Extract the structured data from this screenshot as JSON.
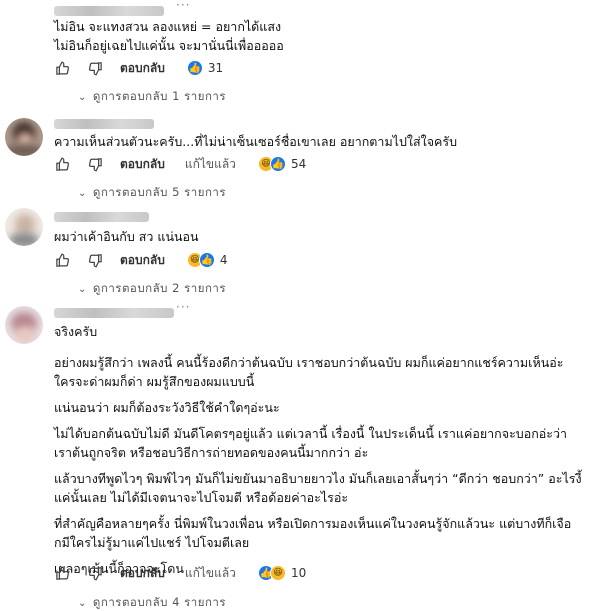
{
  "comments": [
    {
      "paragraphs": [
        "ไม่อิน จะแทงสวน ลองแหย่ = อยากได้แสง\nไม่อินก็อยู่เฉยไปแค่นั้น จะมานั่นนี่เพื่อออออ"
      ],
      "actions": {
        "reply": "ตอบกลับ",
        "edit": ""
      },
      "reactions": [
        "like"
      ],
      "reaction_count": "31",
      "replies_label": "ดูการตอบกลับ 1 รายการ"
    },
    {
      "paragraphs": [
        "ความเห็นส่วนตัวนะครับ...ที่ไม่น่าเซ็นเซอร์ชื่อเขาเลย อยากตามไปใส่ใจครับ"
      ],
      "actions": {
        "reply": "ตอบกลับ",
        "edit": "แก้ไขแล้ว"
      },
      "reactions": [
        "haha",
        "like"
      ],
      "reaction_count": "54",
      "replies_label": "ดูการตอบกลับ 5 รายการ"
    },
    {
      "paragraphs": [
        "ผมว่าเค้าอินกับ สว แน่นอน"
      ],
      "actions": {
        "reply": "ตอบกลับ",
        "edit": ""
      },
      "reactions": [
        "haha",
        "like"
      ],
      "reaction_count": "4",
      "replies_label": "ดูการตอบกลับ 2 รายการ"
    },
    {
      "paragraphs": [
        "จริงครับ",
        "อย่างผมรู้สึกว่า เพลงนี้ คนนี้ร้องดีกว่าต้นฉบับ เราชอบกว่าต้นฉบับ ผมก็แค่อยากแชร์ความเห็นอ่ะ\nใครจะด่าผมก็ด่า ผมรู้สึกของผมแบบนี้",
        "แน่นอนว่า ผมก็ต้องระวังวิธีใช้คำใดๆอ่ะนะ",
        "ไม่ได้บอกต้นฉบับไม่ดี มันดีโคตรๆอยู่แล้ว แต่เวลานี้ เรื่องนี้ ในประเด็นนี้ เราแค่อยากจะบอกอ่ะว่า\nเราต้นถูกจริต หรือชอบวิธีการถ่ายทอดของคนนี้มากกว่า อ่ะ",
        "แล้วบางทีพูดไวๆ พิมพ์ไวๆ มันก็ไม่ขยันมาอธิบายยาวไง มันก็เลยเอาสั้นๆว่า “ดีกว่า ชอบกว่า” อะไรงี้\nแค่นั้นเลย ไม่ได้มีเจตนาจะไปโจมตี หรือด้อยค่าอะไรอ่ะ",
        "ที่สำคัญคือหลายๆครั้ง นี่พิมพ์ในวงเพื่อน หรือเปิดการมองเห็นแค่ในวงคนรู้จักแล้วนะ แต่บางทีก็เจือ\nกมีใครไม่รู้มาแค่ไปแชร์ ไปโจมตีเลย",
        "เผลอๆเม้นนี้ก็อาจจะโดน"
      ],
      "actions": {
        "reply": "ตอบกลับ",
        "edit": "แก้ไขแล้ว"
      },
      "reactions": [
        "like",
        "haha"
      ],
      "reaction_count": "10",
      "replies_label": "ดูการตอบกลับ 4 รายการ"
    }
  ]
}
